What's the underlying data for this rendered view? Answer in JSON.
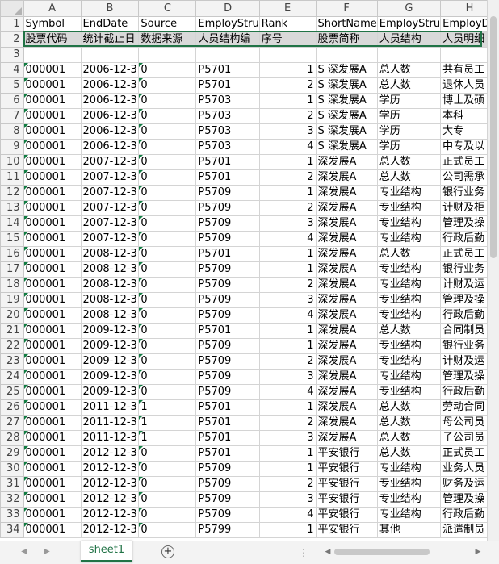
{
  "columns": [
    "A",
    "B",
    "C",
    "D",
    "E",
    "F",
    "G",
    "H"
  ],
  "header_row": {
    "num": "1",
    "cells": [
      "Symbol",
      "EndDate",
      "Source",
      "EmployStru",
      "Rank",
      "ShortName",
      "EmployStru",
      "EmployDe"
    ]
  },
  "desc_row": {
    "num": "2",
    "cells": [
      "股票代码",
      "统计截止日",
      "数据来源",
      "人员结构编",
      "序号",
      "股票简称",
      "人员结构",
      "人员明细"
    ]
  },
  "empty_row": {
    "num": "3"
  },
  "rows": [
    {
      "num": "4",
      "a": "000001",
      "b": "2006-12-3",
      "c": "0",
      "d": "P5701",
      "e": "1",
      "f": "S 深发展A",
      "g": "总人数",
      "h": "共有员工"
    },
    {
      "num": "5",
      "a": "000001",
      "b": "2006-12-3",
      "c": "0",
      "d": "P5701",
      "e": "2",
      "f": "S 深发展A",
      "g": "总人数",
      "h": "退休人员"
    },
    {
      "num": "6",
      "a": "000001",
      "b": "2006-12-3",
      "c": "0",
      "d": "P5703",
      "e": "1",
      "f": "S 深发展A",
      "g": "学历",
      "h": "博士及硕"
    },
    {
      "num": "7",
      "a": "000001",
      "b": "2006-12-3",
      "c": "0",
      "d": "P5703",
      "e": "2",
      "f": "S 深发展A",
      "g": "学历",
      "h": "本科"
    },
    {
      "num": "8",
      "a": "000001",
      "b": "2006-12-3",
      "c": "0",
      "d": "P5703",
      "e": "3",
      "f": "S 深发展A",
      "g": "学历",
      "h": "大专"
    },
    {
      "num": "9",
      "a": "000001",
      "b": "2006-12-3",
      "c": "0",
      "d": "P5703",
      "e": "4",
      "f": "S 深发展A",
      "g": "学历",
      "h": "中专及以"
    },
    {
      "num": "10",
      "a": "000001",
      "b": "2007-12-3",
      "c": "0",
      "d": "P5701",
      "e": "1",
      "f": "深发展A",
      "g": "总人数",
      "h": "正式员工"
    },
    {
      "num": "11",
      "a": "000001",
      "b": "2007-12-3",
      "c": "0",
      "d": "P5701",
      "e": "2",
      "f": "深发展A",
      "g": "总人数",
      "h": "公司需承"
    },
    {
      "num": "12",
      "a": "000001",
      "b": "2007-12-3",
      "c": "0",
      "d": "P5709",
      "e": "1",
      "f": "深发展A",
      "g": "专业结构",
      "h": "银行业务"
    },
    {
      "num": "13",
      "a": "000001",
      "b": "2007-12-3",
      "c": "0",
      "d": "P5709",
      "e": "2",
      "f": "深发展A",
      "g": "专业结构",
      "h": "计财及柜"
    },
    {
      "num": "14",
      "a": "000001",
      "b": "2007-12-3",
      "c": "0",
      "d": "P5709",
      "e": "3",
      "f": "深发展A",
      "g": "专业结构",
      "h": "管理及操"
    },
    {
      "num": "15",
      "a": "000001",
      "b": "2007-12-3",
      "c": "0",
      "d": "P5709",
      "e": "4",
      "f": "深发展A",
      "g": "专业结构",
      "h": "行政后勤"
    },
    {
      "num": "16",
      "a": "000001",
      "b": "2008-12-3",
      "c": "0",
      "d": "P5701",
      "e": "1",
      "f": "深发展A",
      "g": "总人数",
      "h": "正式员工"
    },
    {
      "num": "17",
      "a": "000001",
      "b": "2008-12-3",
      "c": "0",
      "d": "P5709",
      "e": "1",
      "f": "深发展A",
      "g": "专业结构",
      "h": "银行业务"
    },
    {
      "num": "18",
      "a": "000001",
      "b": "2008-12-3",
      "c": "0",
      "d": "P5709",
      "e": "2",
      "f": "深发展A",
      "g": "专业结构",
      "h": "计财及运"
    },
    {
      "num": "19",
      "a": "000001",
      "b": "2008-12-3",
      "c": "0",
      "d": "P5709",
      "e": "3",
      "f": "深发展A",
      "g": "专业结构",
      "h": "管理及操"
    },
    {
      "num": "20",
      "a": "000001",
      "b": "2008-12-3",
      "c": "0",
      "d": "P5709",
      "e": "4",
      "f": "深发展A",
      "g": "专业结构",
      "h": "行政后勤"
    },
    {
      "num": "21",
      "a": "000001",
      "b": "2009-12-3",
      "c": "0",
      "d": "P5701",
      "e": "1",
      "f": "深发展A",
      "g": "总人数",
      "h": "合同制员"
    },
    {
      "num": "22",
      "a": "000001",
      "b": "2009-12-3",
      "c": "0",
      "d": "P5709",
      "e": "1",
      "f": "深发展A",
      "g": "专业结构",
      "h": "银行业务"
    },
    {
      "num": "23",
      "a": "000001",
      "b": "2009-12-3",
      "c": "0",
      "d": "P5709",
      "e": "2",
      "f": "深发展A",
      "g": "专业结构",
      "h": "计财及运"
    },
    {
      "num": "24",
      "a": "000001",
      "b": "2009-12-3",
      "c": "0",
      "d": "P5709",
      "e": "3",
      "f": "深发展A",
      "g": "专业结构",
      "h": "管理及操"
    },
    {
      "num": "25",
      "a": "000001",
      "b": "2009-12-3",
      "c": "0",
      "d": "P5709",
      "e": "4",
      "f": "深发展A",
      "g": "专业结构",
      "h": "行政后勤"
    },
    {
      "num": "26",
      "a": "000001",
      "b": "2011-12-3",
      "c": "1",
      "d": "P5701",
      "e": "1",
      "f": "深发展A",
      "g": "总人数",
      "h": "劳动合同"
    },
    {
      "num": "27",
      "a": "000001",
      "b": "2011-12-3",
      "c": "1",
      "d": "P5701",
      "e": "2",
      "f": "深发展A",
      "g": "总人数",
      "h": "母公司员"
    },
    {
      "num": "28",
      "a": "000001",
      "b": "2011-12-3",
      "c": "1",
      "d": "P5701",
      "e": "3",
      "f": "深发展A",
      "g": "总人数",
      "h": "子公司员"
    },
    {
      "num": "29",
      "a": "000001",
      "b": "2012-12-3",
      "c": "0",
      "d": "P5701",
      "e": "1",
      "f": "平安银行",
      "g": "总人数",
      "h": "正式员工"
    },
    {
      "num": "30",
      "a": "000001",
      "b": "2012-12-3",
      "c": "0",
      "d": "P5709",
      "e": "1",
      "f": "平安银行",
      "g": "专业结构",
      "h": "业务人员"
    },
    {
      "num": "31",
      "a": "000001",
      "b": "2012-12-3",
      "c": "0",
      "d": "P5709",
      "e": "2",
      "f": "平安银行",
      "g": "专业结构",
      "h": "财务及运"
    },
    {
      "num": "32",
      "a": "000001",
      "b": "2012-12-3",
      "c": "0",
      "d": "P5709",
      "e": "3",
      "f": "平安银行",
      "g": "专业结构",
      "h": "管理及操"
    },
    {
      "num": "33",
      "a": "000001",
      "b": "2012-12-3",
      "c": "0",
      "d": "P5709",
      "e": "4",
      "f": "平安银行",
      "g": "专业结构",
      "h": "行政后勤"
    },
    {
      "num": "34",
      "a": "000001",
      "b": "2012-12-3",
      "c": "0",
      "d": "P5799",
      "e": "1",
      "f": "平安银行",
      "g": "其他",
      "h": "派遣制员"
    }
  ],
  "sheet_tab": {
    "label": "sheet1"
  },
  "add_sheet": {
    "label": "+"
  },
  "colors": {
    "accent": "#217346",
    "cell_flag": "#107c41"
  }
}
